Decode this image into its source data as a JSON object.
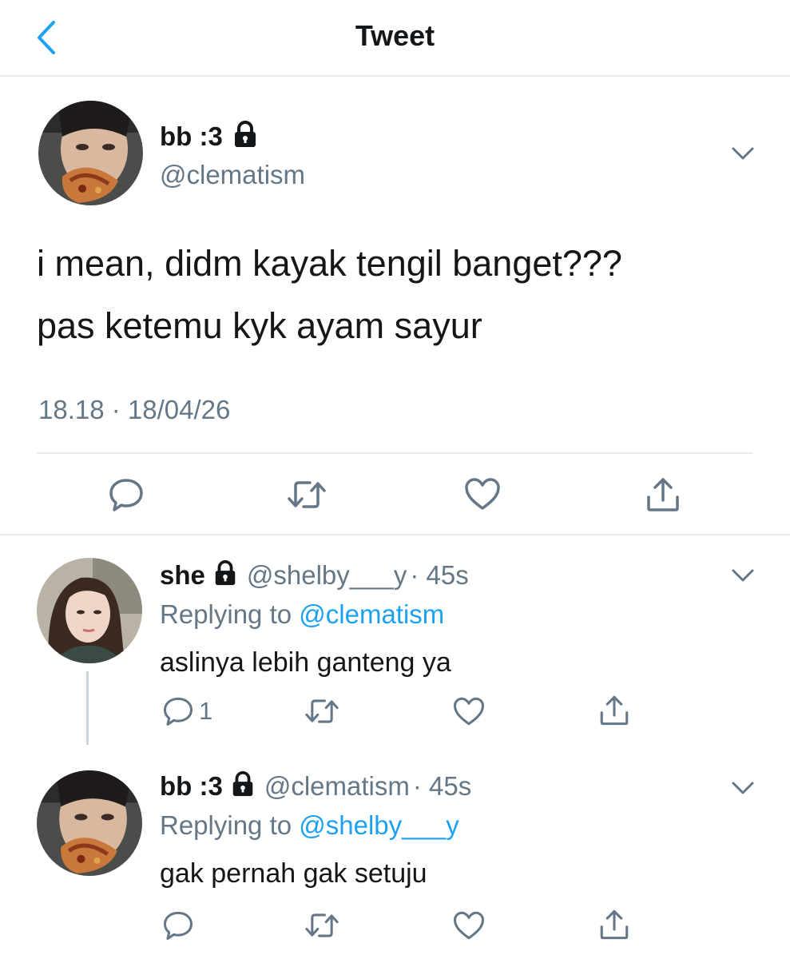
{
  "header": {
    "title": "Tweet",
    "back_icon": "chevron-left-icon",
    "accent_color": "#1da1f2"
  },
  "main_tweet": {
    "display_name": "bb :3",
    "handle": "@clematism",
    "text_line1": "i mean, didm kayak tengil banget???",
    "text_line2": "pas ketemu kyk ayam sayur",
    "timestamp": "18.18 · 18/04/26",
    "locked": true
  },
  "replies": [
    {
      "display_name": "she",
      "handle": "@shelby___y",
      "time": "· 45s",
      "replying_prefix": "Replying to ",
      "replying_to": "@clematism",
      "text": "aslinya lebih ganteng ya",
      "reply_count": "1",
      "locked": true
    },
    {
      "display_name": "bb :3",
      "handle": "@clematism",
      "time": "· 45s",
      "replying_prefix": "Replying to ",
      "replying_to": "@shelby___y",
      "text": "gak pernah gak setuju",
      "reply_count": "",
      "locked": true
    }
  ],
  "colors": {
    "text": "#14171a",
    "secondary": "#657786",
    "link": "#1da1f2",
    "border": "#e6ecf0"
  }
}
